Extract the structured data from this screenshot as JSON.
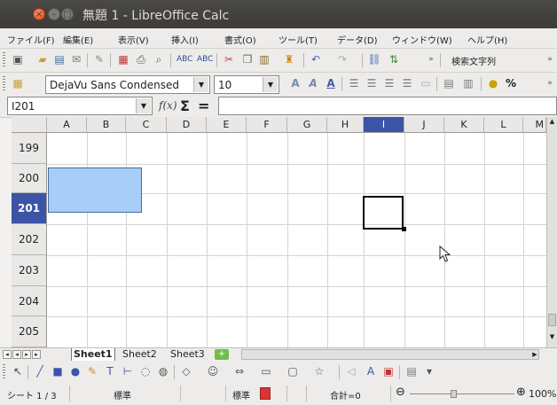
{
  "window": {
    "title": "無題 1 - LibreOffice Calc"
  },
  "menu": [
    "ファイル(F)",
    "編集(E)",
    "表示(V)",
    "挿入(I)",
    "書式(O)",
    "ツール(T)",
    "データ(D)",
    "ウィンドウ(W)",
    "ヘルプ(H)"
  ],
  "toolbar": {
    "find_label": "検索文字列"
  },
  "format": {
    "font_name": "DejaVu Sans Condensed",
    "font_size": "10"
  },
  "formula": {
    "cell_ref": "I201",
    "fx": "f(x)",
    "sum": "Σ",
    "equals": "=",
    "content": ""
  },
  "grid": {
    "columns": [
      "A",
      "B",
      "C",
      "D",
      "E",
      "F",
      "G",
      "H",
      "I",
      "J",
      "K",
      "L",
      "M"
    ],
    "selected_column": "I",
    "rows": [
      "199",
      "200",
      "201",
      "202",
      "203",
      "204",
      "205"
    ],
    "selected_row": "201",
    "active_cell": "I201",
    "highlight_range": "A200:B201",
    "highlight_color": "#a8cdf7"
  },
  "sheets": {
    "tabs": [
      "Sheet1",
      "Sheet2",
      "Sheet3"
    ],
    "active": "Sheet1",
    "add_icon": "plus-icon"
  },
  "status": {
    "sheet": "シート 1 / 3",
    "page_style": "標準",
    "mode": "標準",
    "sum": "合計=0",
    "zoom": "100%"
  },
  "colors": {
    "accent": "#3c54a8",
    "selection": "#a8cdf7",
    "titlebar": "#3c3b37"
  }
}
